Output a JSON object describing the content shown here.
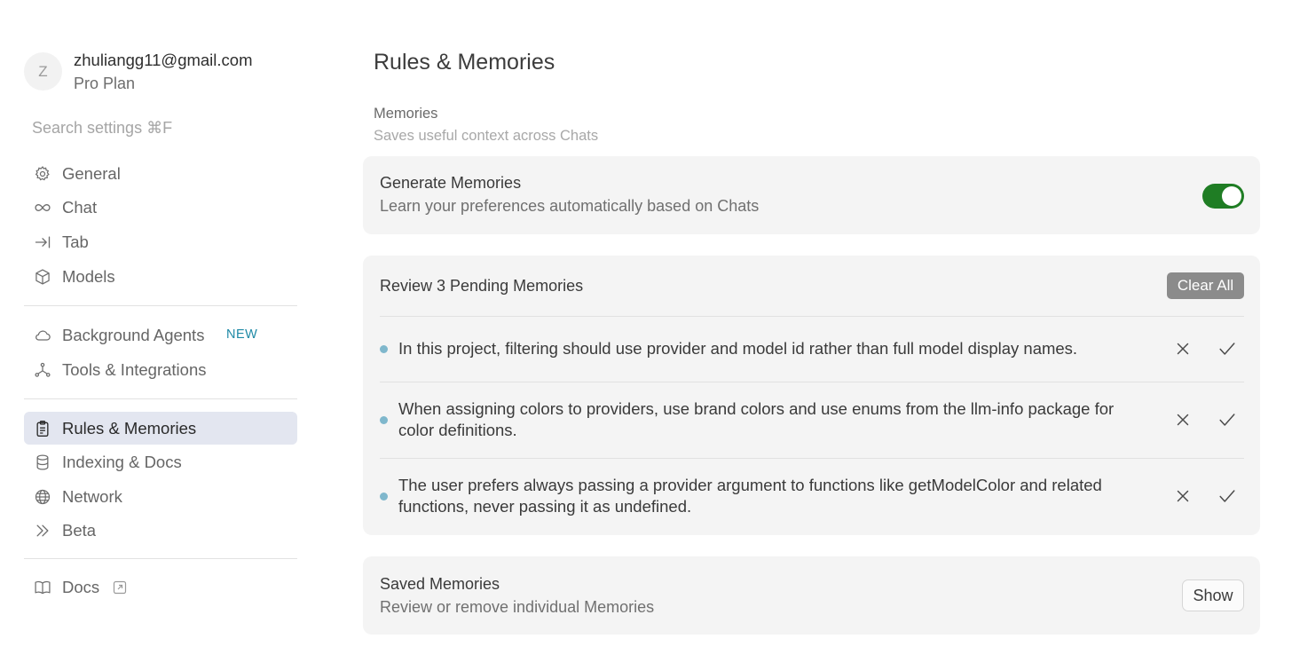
{
  "account": {
    "avatar_letter": "Z",
    "email": "zhuliangg11@gmail.com",
    "plan": "Pro Plan"
  },
  "search": {
    "placeholder": "Search settings ⌘F"
  },
  "sidebar": {
    "items": [
      {
        "label": "General",
        "icon": "gear-icon"
      },
      {
        "label": "Chat",
        "icon": "infinity-icon"
      },
      {
        "label": "Tab",
        "icon": "arrow-to-line-icon"
      },
      {
        "label": "Models",
        "icon": "cube-icon"
      },
      {
        "label": "Background Agents",
        "icon": "cloud-icon",
        "badge": "NEW"
      },
      {
        "label": "Tools & Integrations",
        "icon": "network-nodes-icon"
      },
      {
        "label": "Rules & Memories",
        "icon": "clipboard-icon",
        "active": true
      },
      {
        "label": "Indexing & Docs",
        "icon": "database-icon"
      },
      {
        "label": "Network",
        "icon": "globe-icon"
      },
      {
        "label": "Beta",
        "icon": "double-chevron-right-icon"
      },
      {
        "label": "Docs",
        "icon": "book-icon",
        "external": true
      }
    ]
  },
  "main": {
    "title": "Rules & Memories",
    "memories_section": {
      "label": "Memories",
      "description": "Saves useful context across Chats"
    },
    "generate_card": {
      "title": "Generate Memories",
      "subtitle": "Learn your preferences automatically based on Chats",
      "toggle_on": true,
      "toggle_color": "#1f7d24"
    },
    "pending_card": {
      "title": "Review 3 Pending Memories",
      "clear_label": "Clear All",
      "items": [
        {
          "text": "In this project, filtering should use provider and model id rather than full model display names."
        },
        {
          "text": "When assigning colors to providers, use brand colors and use enums from the llm-info package for color definitions."
        },
        {
          "text": "The user prefers always passing a provider argument to functions like getModelColor and related functions, never passing it as undefined."
        }
      ]
    },
    "saved_card": {
      "title": "Saved Memories",
      "subtitle": "Review or remove individual Memories",
      "show_label": "Show"
    }
  },
  "colors": {
    "active_nav_bg": "#e3e6f0",
    "new_badge": "#1f8aa6",
    "memory_dot": "#7fb7cc",
    "clear_button_bg": "#8b8b8b"
  }
}
